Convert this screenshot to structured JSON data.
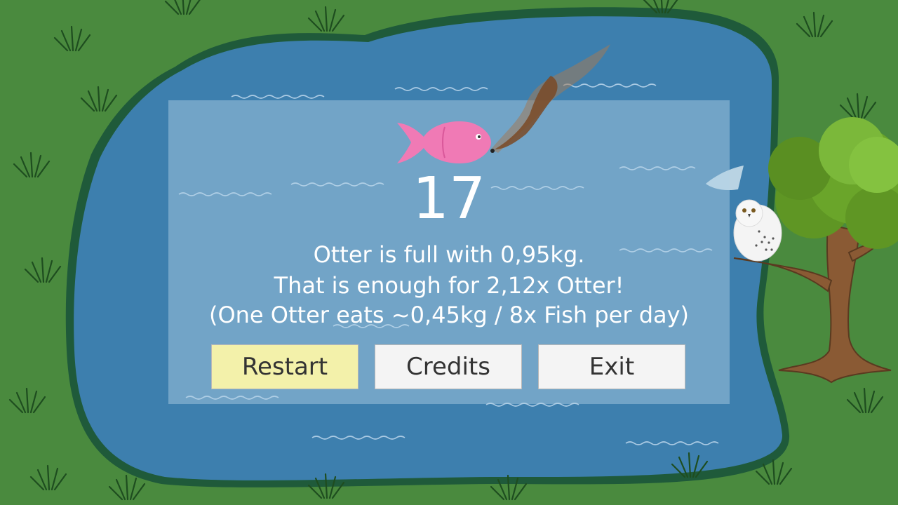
{
  "score": "17",
  "messages": {
    "line1": "Otter is full with 0,95kg.",
    "line2": "That is enough for 2,12x Otter!",
    "line3": "(One Otter eats ~0,45kg / 8x Fish per day)"
  },
  "buttons": {
    "restart": "Restart",
    "credits": "Credits",
    "exit": "Exit"
  },
  "colors": {
    "grass": "#4a8a3e",
    "pond": "#3d7fae",
    "pond_edge": "#1f5a3a",
    "restart_highlight": "#f3f1aa",
    "fish": "#f07ab5"
  },
  "icons": {
    "fish": "fish-icon",
    "otter": "otter-icon",
    "owl": "owl-icon",
    "tree": "tree-icon"
  }
}
